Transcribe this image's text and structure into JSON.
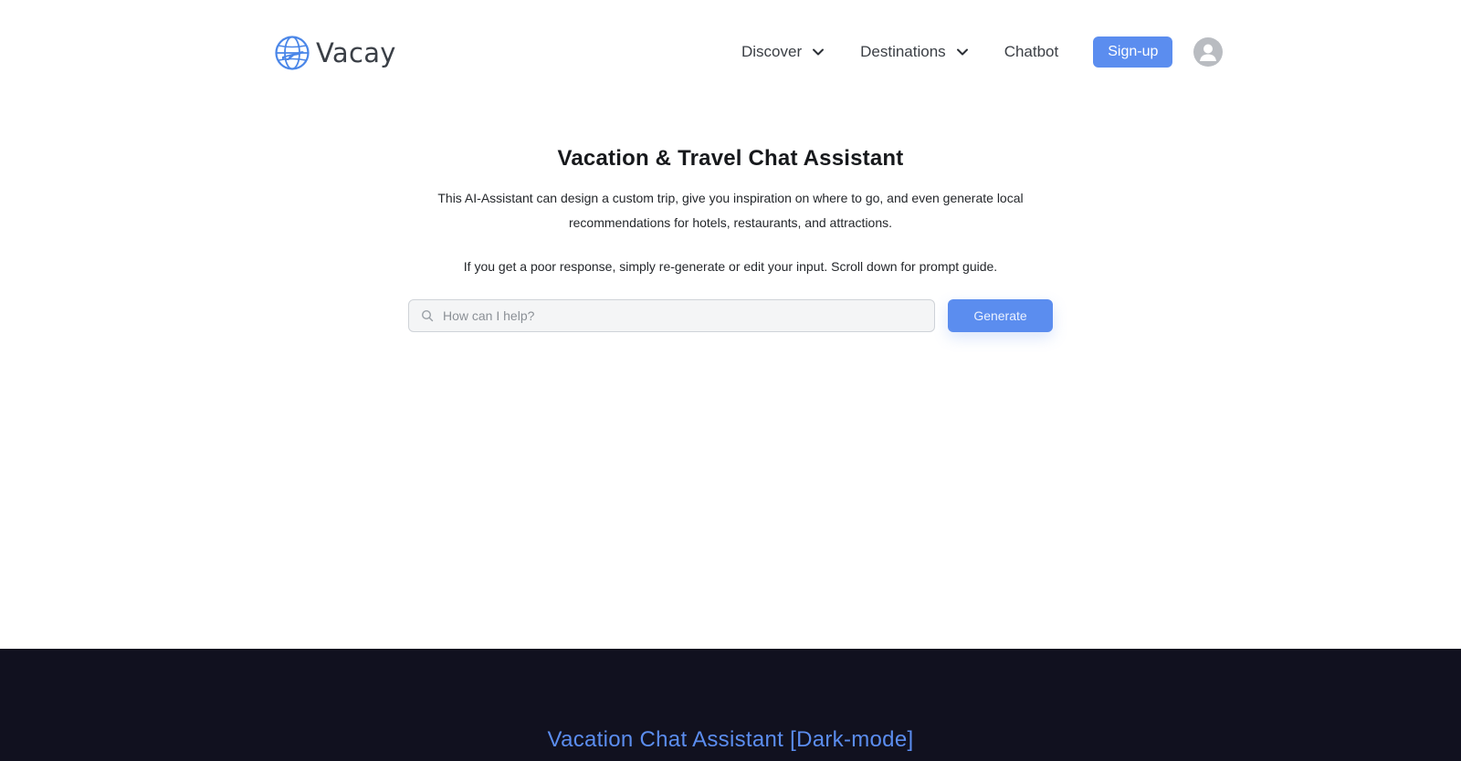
{
  "brand": {
    "name": "Vacay",
    "logo_icon": "globe-airplane-icon"
  },
  "nav": {
    "discover": "Discover",
    "destinations": "Destinations",
    "chatbot": "Chatbot",
    "signup": "Sign-up",
    "avatar_icon": "user-avatar-icon"
  },
  "hero": {
    "title": "Vacation & Travel Chat Assistant",
    "description": "This AI-Assistant can design a custom trip, give you inspiration on where to go, and even generate local recommendations for hotels, restaurants, and attractions.",
    "note": "If you get a poor response, simply re-generate or edit your input. Scroll down for prompt guide."
  },
  "search": {
    "placeholder": "How can I help?",
    "value": "",
    "button": "Generate"
  },
  "dark_section": {
    "title": "Vacation Chat Assistant [Dark-mode]"
  },
  "colors": {
    "accent": "#5b8def",
    "dark_bg": "#11111f",
    "avatar_bg": "#b9bcc1"
  }
}
